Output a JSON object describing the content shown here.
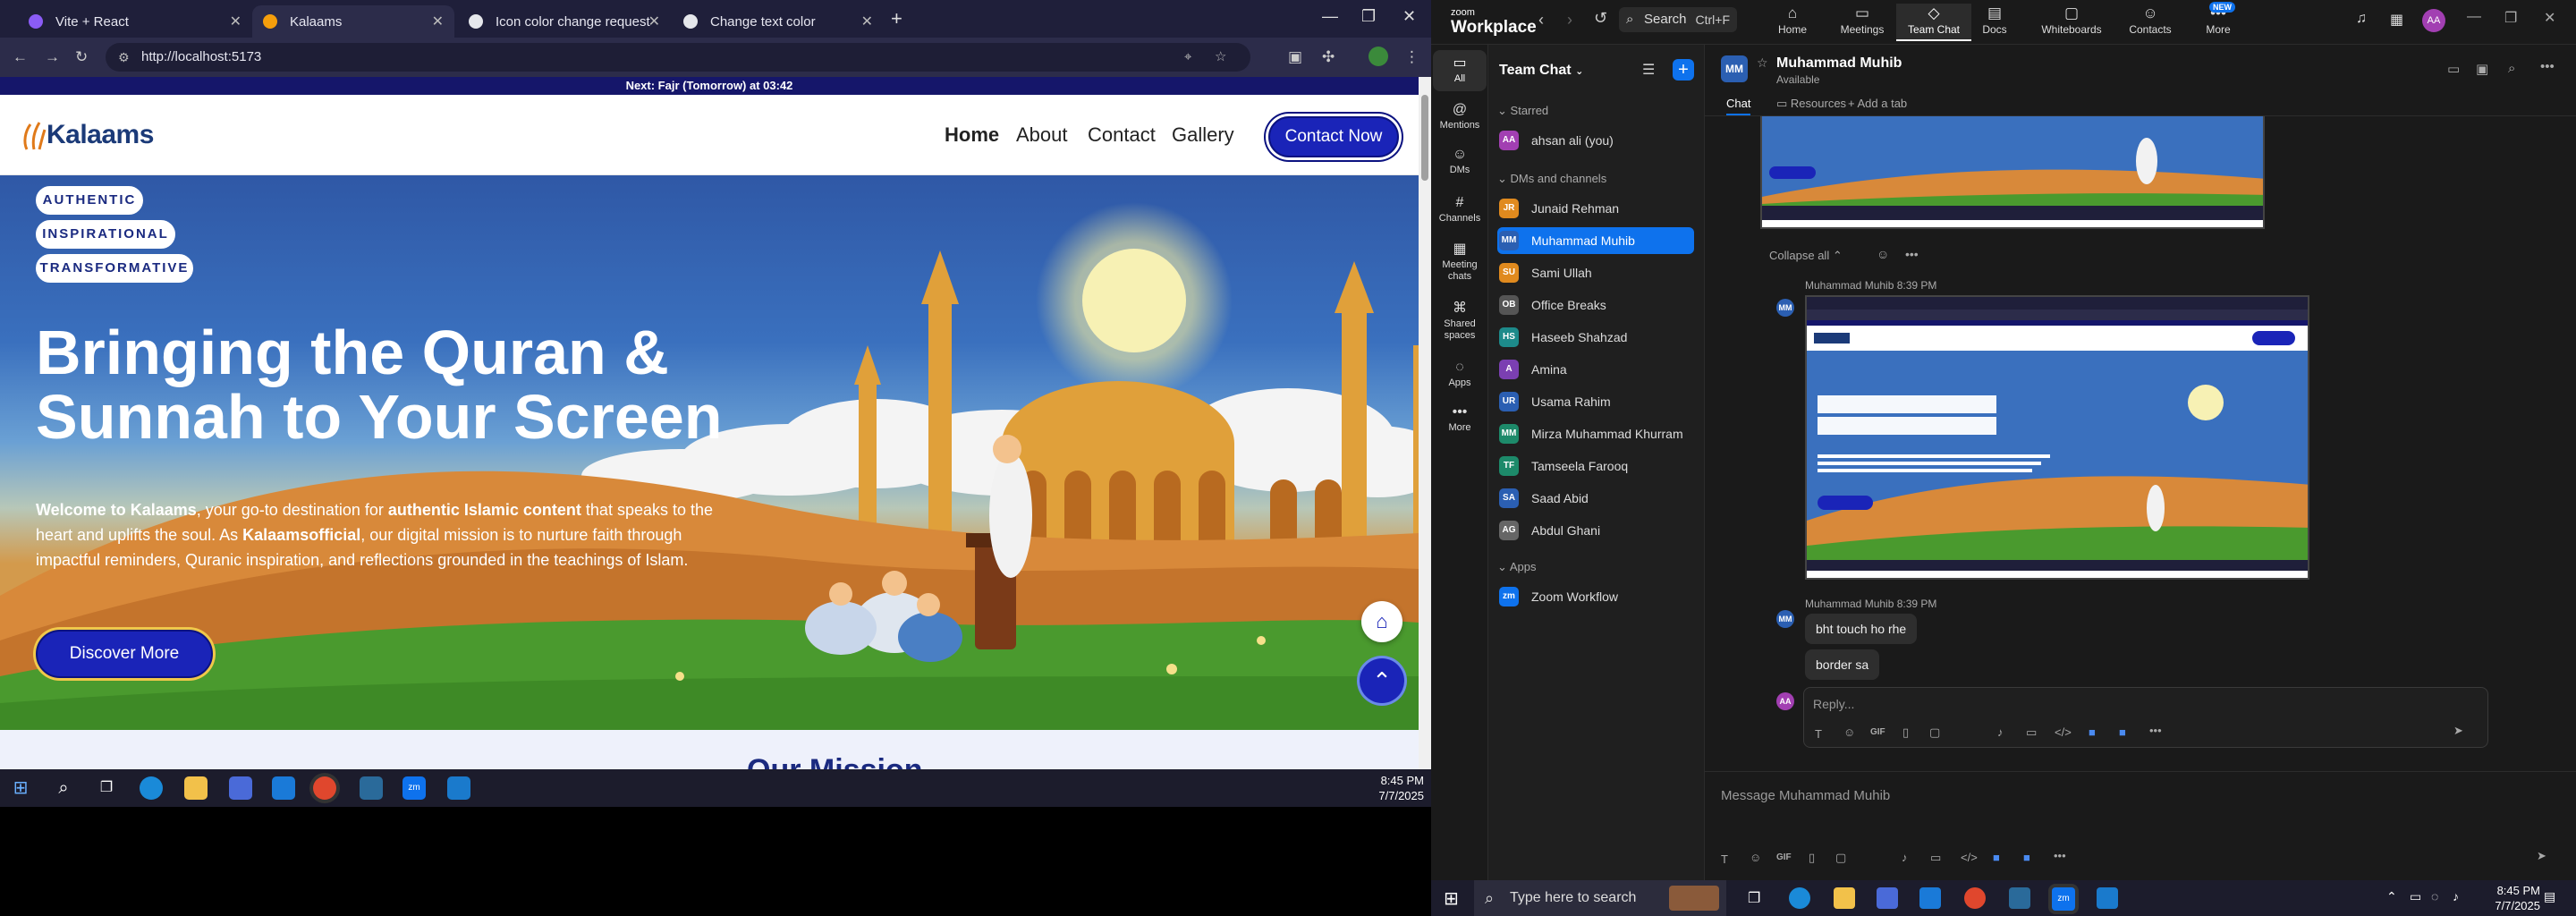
{
  "chrome": {
    "tabs": [
      {
        "title": "Vite + React",
        "favicon_color": "#8b5cf6"
      },
      {
        "title": "Kalaams",
        "favicon_color": "#f59e0b"
      },
      {
        "title": "Icon color change request",
        "favicon_color": "#e5e7eb"
      },
      {
        "title": "Change text color",
        "favicon_color": "#e5e7eb"
      }
    ],
    "url": "http://localhost:5173"
  },
  "site": {
    "prayer_bar": "Next: Fajr (Tomorrow) at 03:42",
    "logo": "Kalaams",
    "nav": [
      "Home",
      "About",
      "Contact",
      "Gallery"
    ],
    "contact_button": "Contact Now",
    "pills": [
      "AUTHENTIC",
      "INSPIRATIONAL",
      "TRANSFORMATIVE"
    ],
    "hero_title_line1": "Bringing the Quran &",
    "hero_title_line2": "Sunnah to Your Screen",
    "hero_desc": {
      "p1": "Welcome to Kalaams",
      "p2": ", your go-to destination for ",
      "p3": "authentic Islamic content",
      "p4": " that speaks to the heart and uplifts the soul. As ",
      "p5": "Kalaamsofficial",
      "p6": ", our digital mission is to nurture faith through impactful reminders, Quranic inspiration, and reflections grounded in the teachings of Islam."
    },
    "discover_button": "Discover More",
    "section_heading": "Our Mission"
  },
  "left_taskbar": {
    "time": "8:45 PM",
    "date": "7/7/2025"
  },
  "zoom": {
    "brand_small": "zoom",
    "brand": "Workplace",
    "search": "Search",
    "search_shortcut": "Ctrl+F",
    "top_nav": [
      "Home",
      "Meetings",
      "Team Chat",
      "Docs",
      "Whiteboards",
      "Contacts",
      "More"
    ],
    "new_badge": "NEW",
    "user_initials": "AA",
    "rail": [
      "All",
      "Mentions",
      "DMs",
      "Channels",
      "Meeting chats",
      "Shared spaces",
      "Apps",
      "More"
    ],
    "sidebar_title": "Team Chat",
    "sections": [
      "Starred",
      "DMs and channels",
      "Apps"
    ],
    "starred": [
      {
        "name": "ahsan ali (you)",
        "initials": "AA",
        "color": "#a23fb2"
      }
    ],
    "dms": [
      {
        "name": "Junaid Rehman",
        "initials": "JR",
        "color": "#e08a1e"
      },
      {
        "name": "Muhammad Muhib",
        "initials": "MM",
        "color": "#2b5fb2"
      },
      {
        "name": "Sami Ullah",
        "initials": "SU",
        "color": "#e08a1e"
      },
      {
        "name": "Office Breaks",
        "initials": "OB",
        "color": "#555555"
      },
      {
        "name": "Haseeb Shahzad",
        "initials": "HS",
        "color": "#1d8a8a"
      },
      {
        "name": "Amina",
        "initials": "A",
        "color": "#7b3fb2"
      },
      {
        "name": "Usama Rahim",
        "initials": "UR",
        "color": "#2b5fb2"
      },
      {
        "name": "Mirza Muhammad Khurram",
        "initials": "MM",
        "color": "#1d8a6a"
      },
      {
        "name": "Tamseela Farooq",
        "initials": "TF",
        "color": "#1d8a6a"
      },
      {
        "name": "Saad Abid",
        "initials": "SA",
        "color": "#2b5fb2"
      },
      {
        "name": "Abdul Ghani",
        "initials": "AG",
        "color": "#666666"
      }
    ],
    "apps": [
      {
        "name": "Zoom Workflow",
        "initials": "zm",
        "color": "#0e72ed"
      }
    ],
    "chat_header": {
      "initials": "MM",
      "name": "Muhammad Muhib",
      "status": "Available"
    },
    "chat_tabs": [
      "Chat",
      "Resources",
      "Add a tab"
    ],
    "collapse_all": "Collapse all",
    "messages": [
      {
        "sender": "Muhammad Muhib",
        "time": "8:39 PM"
      },
      {
        "sender": "Muhammad Muhib",
        "time": "8:39 PM",
        "texts": [
          "bht touch ho rhe",
          "border sa"
        ]
      }
    ],
    "reply_placeholder": "Reply...",
    "composer_placeholder": "Message Muhammad Muhib"
  },
  "right_taskbar": {
    "search": "Type here to search",
    "time": "8:45 PM",
    "date": "7/7/2025"
  }
}
